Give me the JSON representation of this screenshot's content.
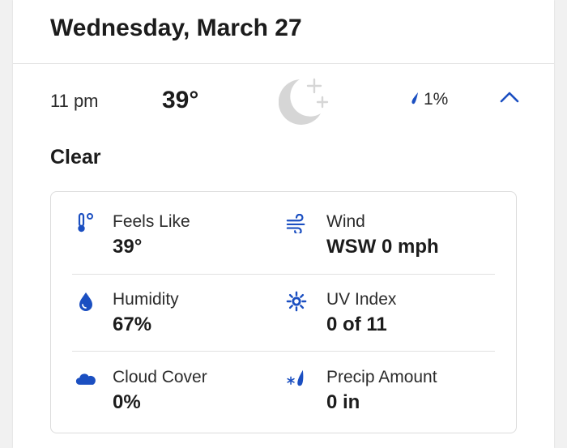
{
  "day": {
    "title": "Wednesday, March 27"
  },
  "hour": {
    "time": "11 pm",
    "temp": "39°",
    "precip_chance": "1%",
    "condition": "Clear",
    "icon": "clear-night-moon-icon"
  },
  "details": {
    "feels_like": {
      "label": "Feels Like",
      "value": "39°",
      "icon": "thermometer-icon"
    },
    "wind": {
      "label": "Wind",
      "value": "WSW 0 mph",
      "icon": "wind-icon"
    },
    "humidity": {
      "label": "Humidity",
      "value": "67%",
      "icon": "humidity-drop-icon"
    },
    "uv_index": {
      "label": "UV Index",
      "value": "0 of 11",
      "icon": "uv-sun-icon"
    },
    "cloud_cover": {
      "label": "Cloud Cover",
      "value": "0%",
      "icon": "cloud-icon"
    },
    "precip_amount": {
      "label": "Precip Amount",
      "value": "0 in",
      "icon": "precip-amount-icon"
    }
  },
  "colors": {
    "accent": "#1b4fc1",
    "moon": "#d6d6d6"
  }
}
